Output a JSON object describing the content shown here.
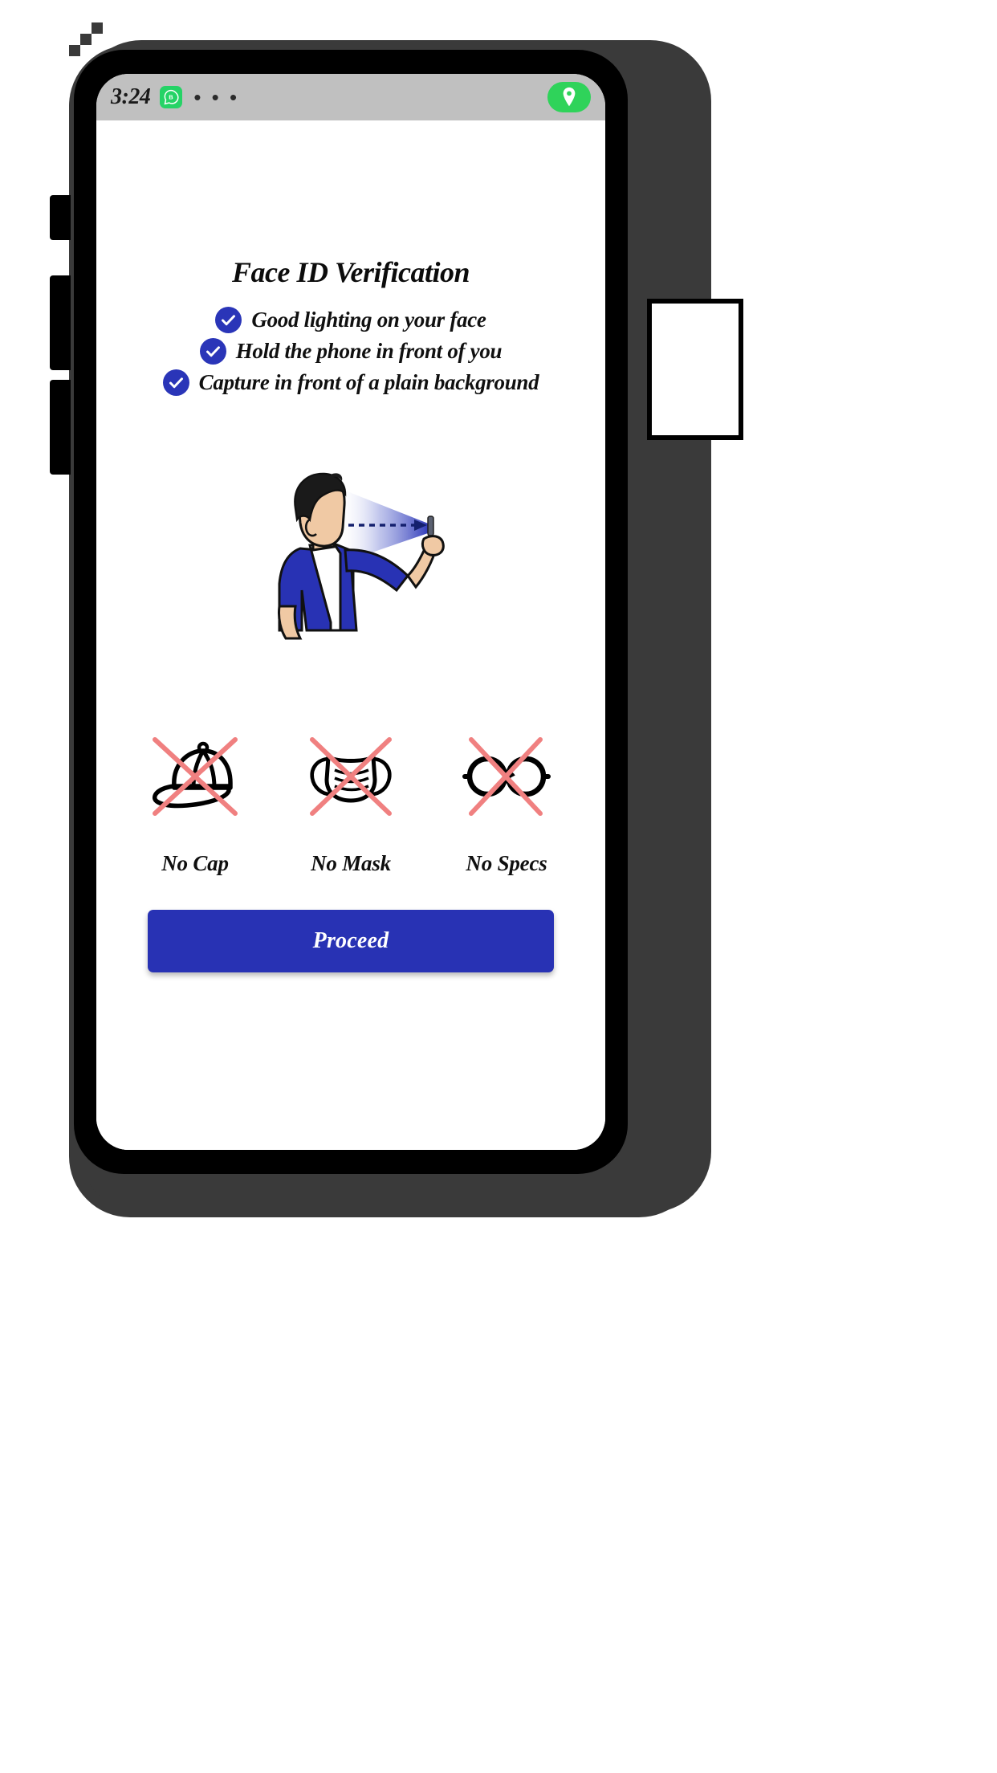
{
  "statusbar": {
    "time": "3:24",
    "app_badge_letter": "B",
    "app_badge_icon": "whatsapp-business-icon",
    "overflow_dots": "• • •",
    "location_pill_icon": "location-pin-icon",
    "badge_color": "#25d366",
    "pill_color": "#2fd35a",
    "bar_color": "#c0c0c0"
  },
  "screen": {
    "title": "Face ID Verification",
    "checklist": [
      {
        "icon": "check-circle-icon",
        "label": "Good lighting on your face"
      },
      {
        "icon": "check-circle-icon",
        "label": "Hold the phone in front of you"
      },
      {
        "icon": "check-circle-icon",
        "label": "Capture in front of a plain background"
      }
    ],
    "illustration": {
      "name": "person-taking-selfie-illustration",
      "shirt_color": "#2832b4",
      "skin_color": "#f0c9a4",
      "hair_color": "#1a1a1a",
      "cone_color": "#2a35b8"
    },
    "rules": [
      {
        "icon": "cap-crossed-icon",
        "label": "No Cap"
      },
      {
        "icon": "mask-crossed-icon",
        "label": "No Mask"
      },
      {
        "icon": "glasses-crossed-icon",
        "label": "No Specs"
      }
    ],
    "cross_color": "#f08080",
    "proceed_label": "Proceed",
    "accent_color": "#2832b4"
  }
}
